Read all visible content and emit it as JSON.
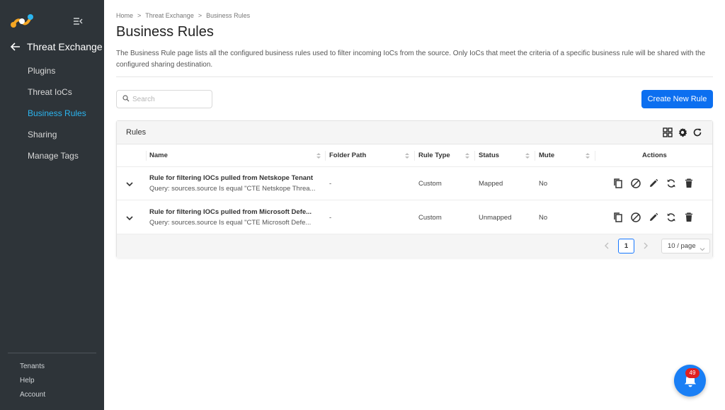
{
  "sidebar": {
    "back_title": "Threat Exchange",
    "items": [
      {
        "label": "Plugins"
      },
      {
        "label": "Threat IoCs"
      },
      {
        "label": "Business Rules"
      },
      {
        "label": "Sharing"
      },
      {
        "label": "Manage Tags"
      }
    ],
    "active_index": 2,
    "footer": [
      {
        "label": "Tenants"
      },
      {
        "label": "Help"
      },
      {
        "label": "Account"
      }
    ]
  },
  "breadcrumb": {
    "items": [
      "Home",
      "Threat Exchange",
      "Business Rules"
    ],
    "separator": ">"
  },
  "page": {
    "title": "Business Rules",
    "description": "The Business Rule page lists all the configured business rules used to filter incoming IoCs from the source. Only IoCs that meet the criteria of a specific business rule will be shared with the configured sharing destination."
  },
  "search": {
    "placeholder": "Search",
    "value": ""
  },
  "create_button": {
    "label": "Create New Rule"
  },
  "card": {
    "title": "Rules"
  },
  "table": {
    "columns": {
      "name": "Name",
      "folder_path": "Folder Path",
      "rule_type": "Rule Type",
      "status": "Status",
      "mute": "Mute",
      "actions": "Actions"
    },
    "rows": [
      {
        "name": "Rule for filtering IOCs pulled from Netskope Tenant",
        "query": "Query: sources.source Is equal \"CTE Netskope Threa...",
        "folder_path": "-",
        "rule_type": "Custom",
        "status": "Mapped",
        "mute": "No"
      },
      {
        "name": "Rule for filtering IOCs pulled from Microsoft Defe...",
        "query": "Query: sources.source Is equal \"CTE Microsoft Defe...",
        "folder_path": "-",
        "rule_type": "Custom",
        "status": "Unmapped",
        "mute": "No"
      }
    ]
  },
  "pagination": {
    "current_page": "1",
    "page_size": "10 / page"
  },
  "notifications": {
    "count": "49"
  },
  "colors": {
    "sidebar_bg": "#2e3439",
    "active_nav": "#2bb5f0",
    "primary": "#0c6ff0",
    "badge": "#e02020"
  }
}
